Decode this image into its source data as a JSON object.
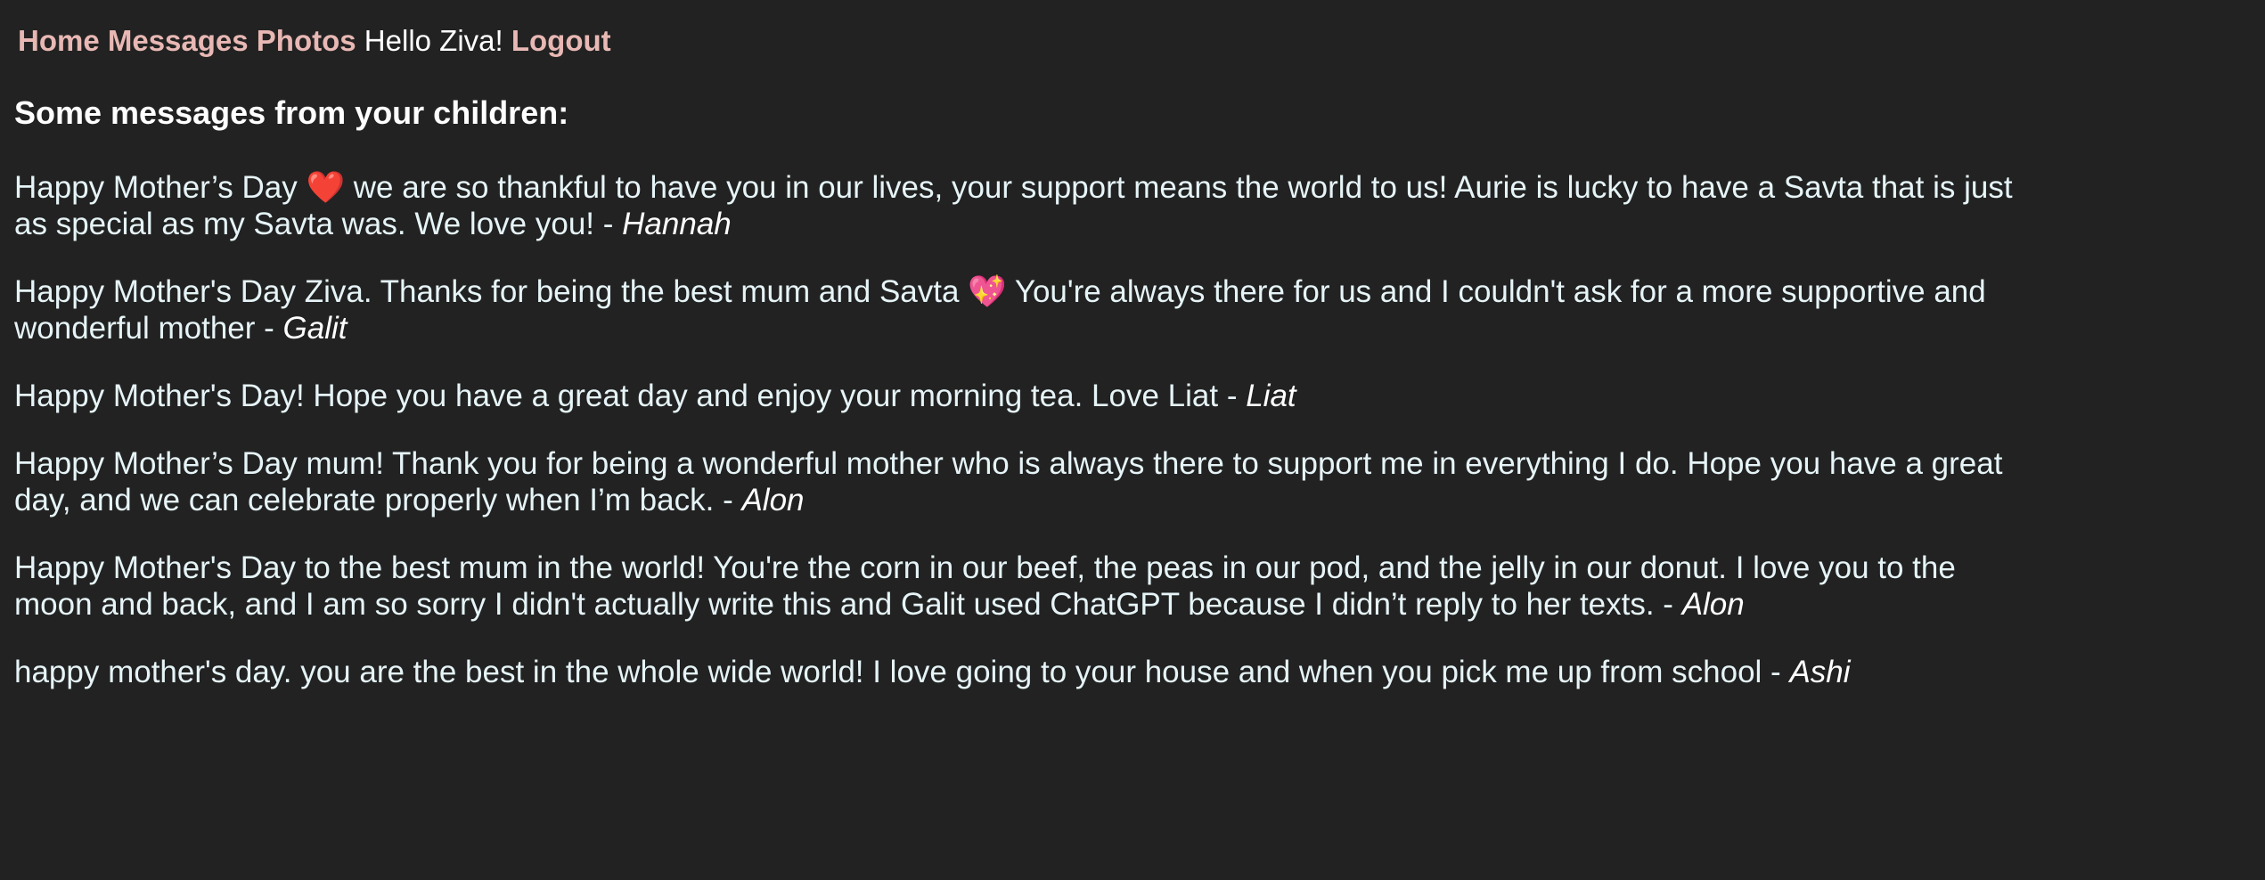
{
  "nav": {
    "home": "Home",
    "messages": "Messages",
    "photos": "Photos",
    "greeting": "Hello Ziva!",
    "logout": "Logout"
  },
  "heading": "Some messages from your children:",
  "separator": " - ",
  "messages": [
    {
      "text": "Happy Mother’s Day ❤️ we are so thankful to have you in our lives, your support means the world to us! Aurie is lucky to have a Savta that is just as special as my Savta was. We love you!",
      "author": "Hannah"
    },
    {
      "text": "Happy Mother's Day Ziva. Thanks for being the best mum and Savta 💖 You're always there for us and I couldn't ask for a more supportive and wonderful mother",
      "author": "Galit"
    },
    {
      "text": "Happy Mother's Day! Hope you have a great day and enjoy your morning tea. Love Liat",
      "author": "Liat"
    },
    {
      "text": "Happy Mother’s Day mum! Thank you for being a wonderful mother who is always there to support me in everything I do. Hope you have a great day, and we can celebrate properly when I’m back.",
      "author": "Alon"
    },
    {
      "text": "Happy Mother's Day to the best mum in the world! You're the corn in our beef, the peas in our pod, and the jelly in our donut. I love you to the moon and back, and I am so sorry I didn't actually write this and Galit used ChatGPT because I didn’t reply to her texts.",
      "author": "Alon"
    },
    {
      "text": "happy mother's day. you are the best in the whole wide world! I love going to your house and when you pick me up from school",
      "author": "Ashi"
    }
  ]
}
